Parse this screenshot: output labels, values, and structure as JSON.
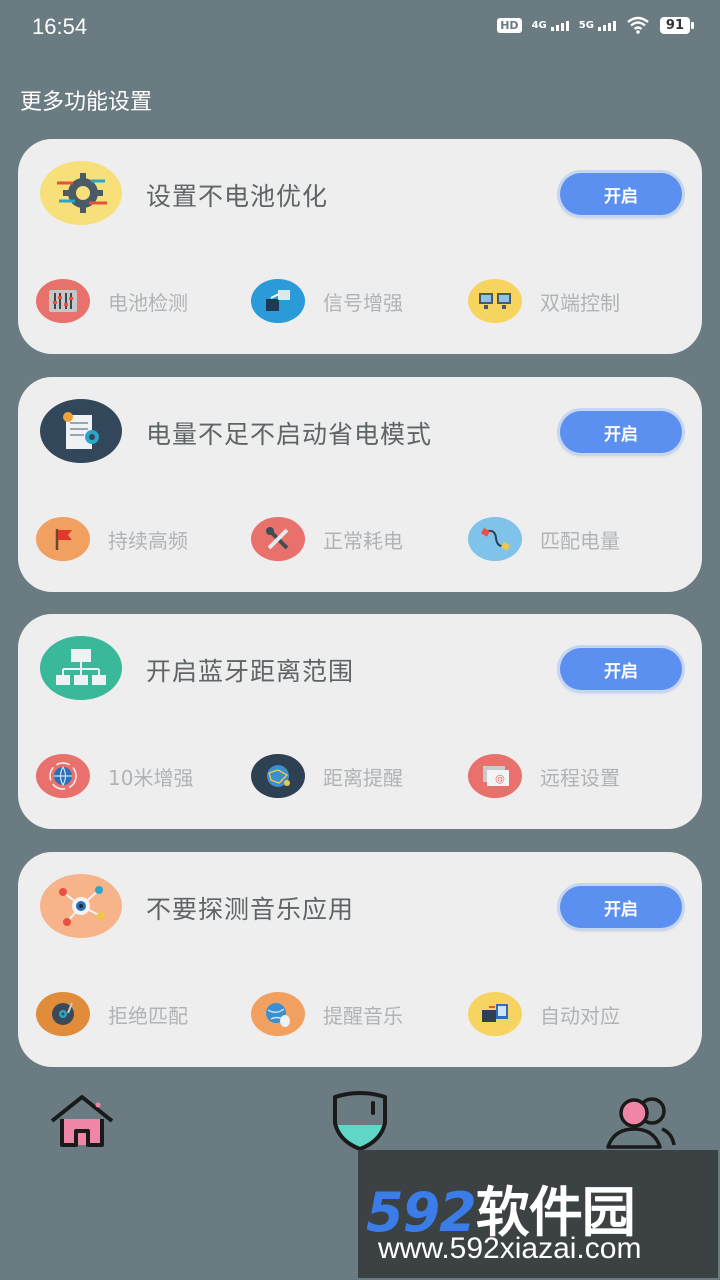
{
  "status": {
    "time": "16:54",
    "hd": "HD",
    "net1": "4G",
    "net2": "5G",
    "battery": "91"
  },
  "page_title": "更多功能设置",
  "cards": [
    {
      "title": "设置不电池优化",
      "button": "开启",
      "icon": "gear-flow-icon",
      "icon_bg": "#f7e07a",
      "features": [
        {
          "label": "电池检测",
          "icon": "equalizer-icon",
          "color": "#e8716c"
        },
        {
          "label": "信号增强",
          "icon": "network-transfer-icon",
          "color": "#2b9ad8"
        },
        {
          "label": "双端控制",
          "icon": "dual-monitor-icon",
          "color": "#f7d460"
        }
      ]
    },
    {
      "title": "电量不足不启动省电模式",
      "button": "开启",
      "icon": "document-settings-icon",
      "icon_bg": "#32485a",
      "features": [
        {
          "label": "持续高频",
          "icon": "flag-icon",
          "color": "#f2a060"
        },
        {
          "label": "正常耗电",
          "icon": "tools-icon",
          "color": "#e8716c"
        },
        {
          "label": "匹配电量",
          "icon": "cable-icon",
          "color": "#7fc2ea"
        }
      ]
    },
    {
      "title": "开启蓝牙距离范围",
      "button": "开启",
      "icon": "sitemap-icon",
      "icon_bg": "#39b89a",
      "features": [
        {
          "label": "10米增强",
          "icon": "globe-refresh-icon",
          "color": "#e8716c"
        },
        {
          "label": "距离提醒",
          "icon": "globe-network-icon",
          "color": "#2e4152"
        },
        {
          "label": "远程设置",
          "icon": "email-window-icon",
          "color": "#e8716c"
        }
      ]
    },
    {
      "title": "不要探测音乐应用",
      "button": "开启",
      "icon": "eye-network-icon",
      "icon_bg": "#f7b48a",
      "features": [
        {
          "label": "拒绝匹配",
          "icon": "vinyl-record-icon",
          "color": "#e08c3a"
        },
        {
          "label": "提醒音乐",
          "icon": "globe-mouse-icon",
          "color": "#f2a060"
        },
        {
          "label": "自动对应",
          "icon": "device-transfer-icon",
          "color": "#f7d460"
        }
      ]
    }
  ],
  "nav": [
    {
      "icon": "home-icon"
    },
    {
      "icon": "shield-icon"
    },
    {
      "icon": "users-icon"
    }
  ],
  "watermark": {
    "logo_num": "592",
    "logo_text": "软件园",
    "url": "www.592xiazai.com"
  }
}
